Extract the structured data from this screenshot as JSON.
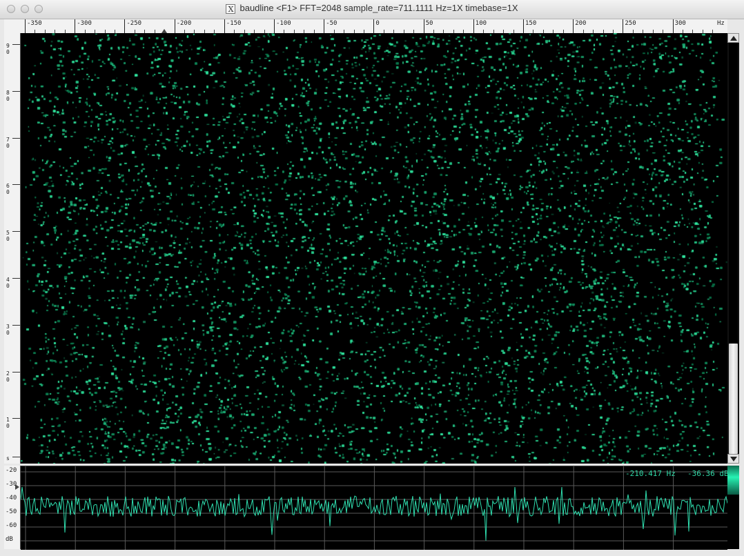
{
  "window": {
    "title": "baudline  <F1> FFT=2048 sample_rate=711.1111 Hz=1X timebase=1X",
    "title_icon": "X"
  },
  "freq_ruler": {
    "labels": [
      "-350",
      "-300",
      "-250",
      "-200",
      "-150",
      "-100",
      "-50",
      "0",
      "50",
      "100",
      "150",
      "200",
      "250",
      "300",
      "Hz"
    ]
  },
  "time_ruler": {
    "labels": [
      "9\n0",
      "8\n0",
      "7\n0",
      "6\n0",
      "5\n0",
      "4\n0",
      "3\n0",
      "2\n0",
      "1\n0",
      "s"
    ]
  },
  "db_ruler": {
    "labels": [
      "-20",
      "-30",
      "-40",
      "-50",
      "-60",
      "dB"
    ]
  },
  "readout": {
    "frequency": "-210.417 Hz",
    "level": "-36.36 dB"
  },
  "colors": {
    "spectrum_trace": "#2fe0b0",
    "spectrogram_dot": "#21d49c",
    "background": "#000000"
  }
}
